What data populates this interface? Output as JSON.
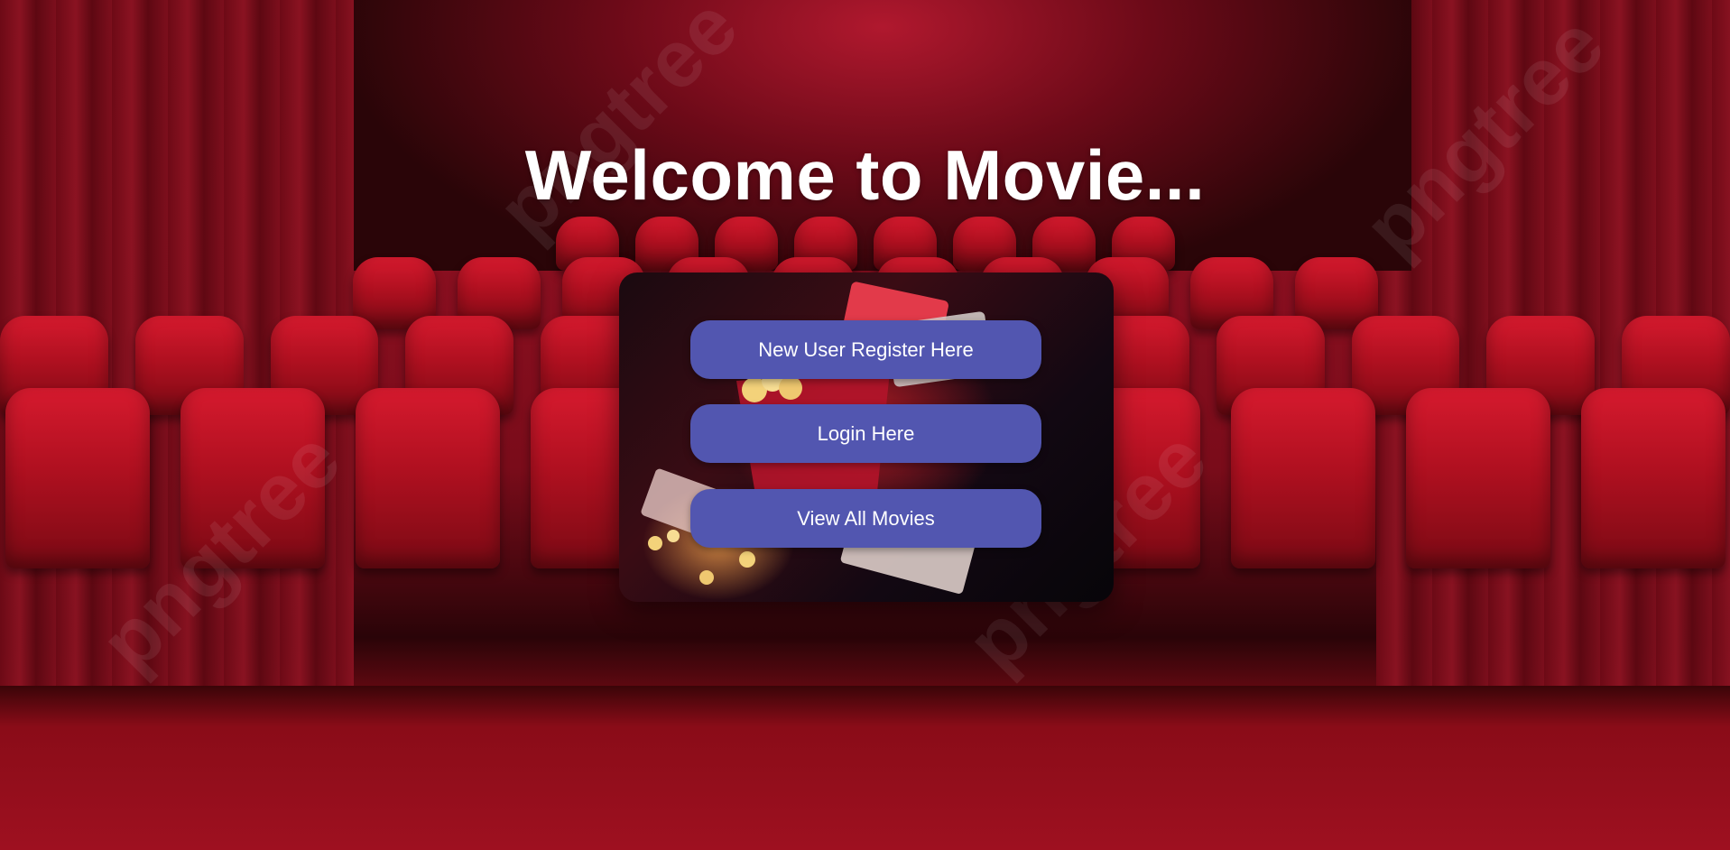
{
  "page": {
    "title": "Welcome to Movie..."
  },
  "actions": {
    "register_label": "New User Register Here",
    "login_label": "Login Here",
    "view_movies_label": "View All Movies"
  },
  "watermark": {
    "text": "pngtree"
  },
  "colors": {
    "button_bg": "#5256b0",
    "button_text": "#ffffff",
    "title_text": "#ffffff",
    "theater_red": "#b01020"
  }
}
